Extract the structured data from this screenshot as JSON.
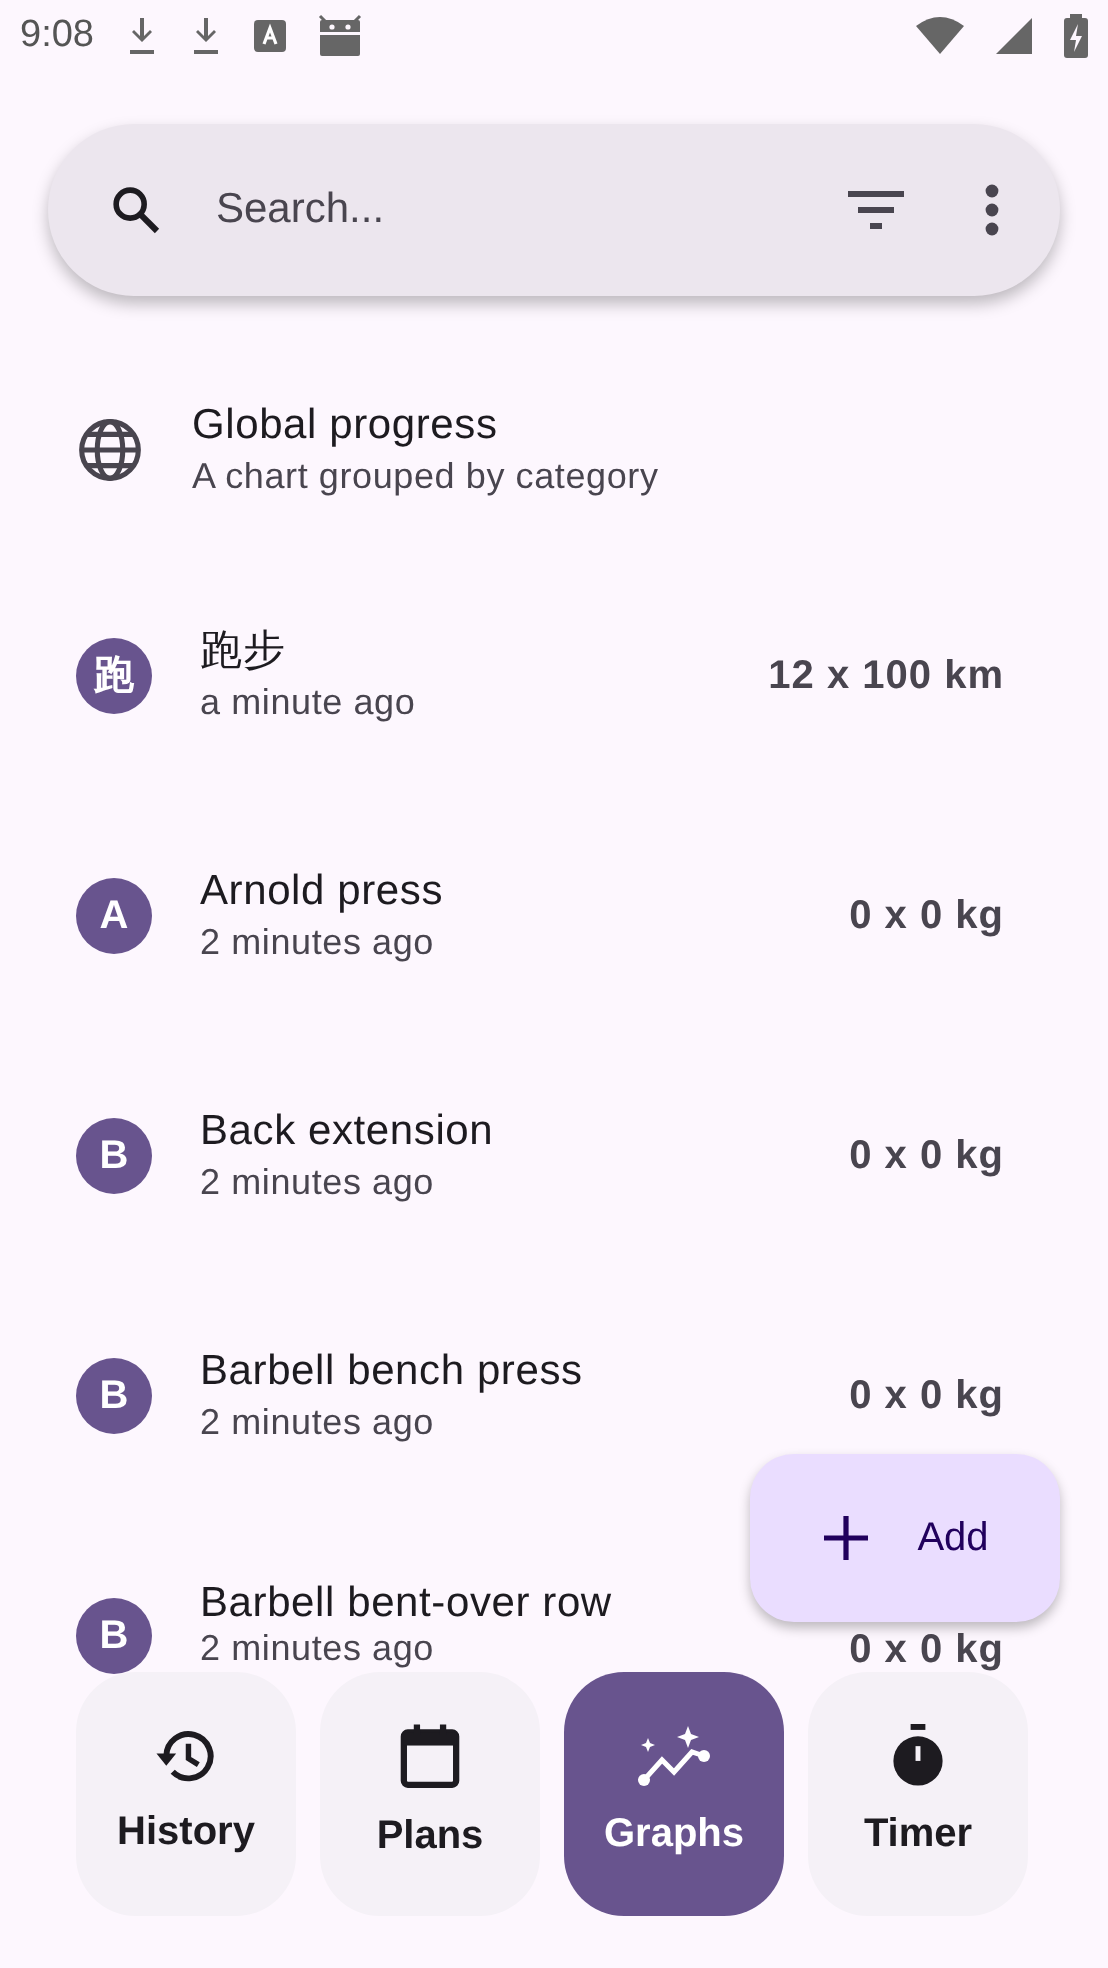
{
  "status_bar": {
    "time": "9:08"
  },
  "search": {
    "placeholder": "Search..."
  },
  "global": {
    "title": "Global progress",
    "subtitle": "A chart grouped by category"
  },
  "items": [
    {
      "letter": "跑",
      "name": "跑步",
      "time": "a minute ago",
      "value": "12 x 100 km"
    },
    {
      "letter": "A",
      "name": "Arnold press",
      "time": "2 minutes ago",
      "value": "0 x 0 kg"
    },
    {
      "letter": "B",
      "name": "Back extension",
      "time": "2 minutes ago",
      "value": "0 x 0 kg"
    },
    {
      "letter": "B",
      "name": "Barbell bench press",
      "time": "2 minutes ago",
      "value": "0 x 0 kg"
    },
    {
      "letter": "B",
      "name": "Barbell bent-over row",
      "time": "2 minutes ago",
      "value": "0 x 0 kg"
    }
  ],
  "fab": {
    "label": "Add"
  },
  "nav": [
    {
      "kind": "history",
      "label": "History",
      "selected": false
    },
    {
      "kind": "plans",
      "label": "Plans",
      "selected": false
    },
    {
      "kind": "graphs",
      "label": "Graphs",
      "selected": true
    },
    {
      "kind": "timer",
      "label": "Timer",
      "selected": false
    }
  ]
}
